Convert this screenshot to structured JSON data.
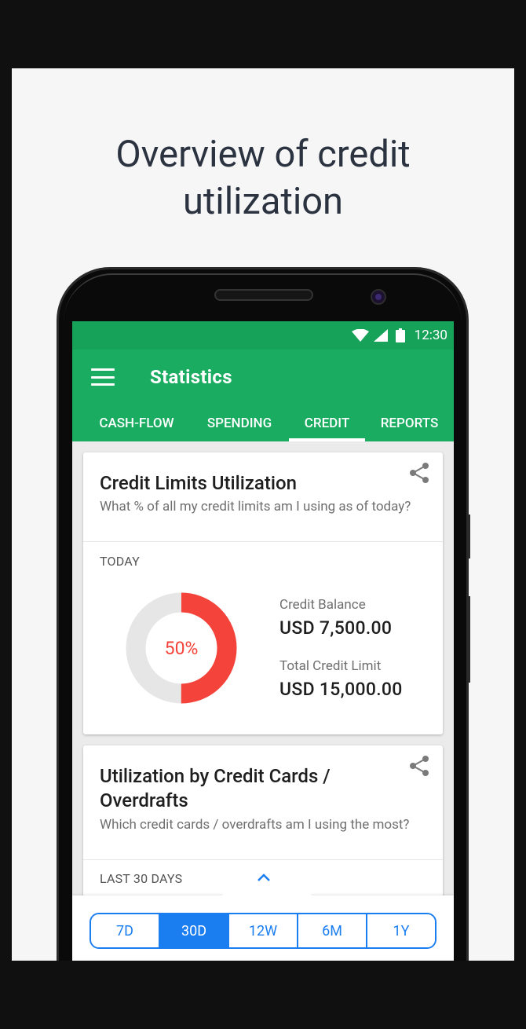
{
  "headline": {
    "line1": "Overview of credit",
    "line2": "utilization"
  },
  "status_bar": {
    "time": "12:30",
    "icons": [
      "wifi-icon",
      "signal-icon",
      "battery-icon"
    ]
  },
  "app_bar": {
    "title": "Statistics",
    "menu_icon": "hamburger-menu-icon"
  },
  "tabs": [
    {
      "label": "CASH-FLOW",
      "active": false
    },
    {
      "label": "SPENDING",
      "active": false
    },
    {
      "label": "CREDIT",
      "active": true
    },
    {
      "label": "REPORTS",
      "active": false
    }
  ],
  "card1": {
    "title": "Credit Limits Utilization",
    "subtitle": "What % of all my credit limits am I using as of today?",
    "period": "TODAY",
    "donut": {
      "percent_label": "50%",
      "percent": 50,
      "used_color": "#F4433A",
      "unused_color": "#E6E6E6"
    },
    "credit_balance_label": "Credit Balance",
    "credit_balance_value": "USD 7,500.00",
    "total_limit_label": "Total Credit Limit",
    "total_limit_value": "USD 15,000.00"
  },
  "card2": {
    "title_line1": "Utilization by Credit Cards /",
    "title_line2": "Overdrafts",
    "subtitle": "Which credit cards / overdrafts am I using the most?",
    "period": "LAST 30 DAYS"
  },
  "range_selector": {
    "options": [
      {
        "label": "7D",
        "active": false
      },
      {
        "label": "30D",
        "active": true
      },
      {
        "label": "12W",
        "active": false
      },
      {
        "label": "6M",
        "active": false
      },
      {
        "label": "1Y",
        "active": false
      }
    ]
  },
  "colors": {
    "brand_green": "#1AAC60",
    "status_green": "#17A25A",
    "accent_blue": "#1B7EF0",
    "danger_red": "#F4433A"
  }
}
